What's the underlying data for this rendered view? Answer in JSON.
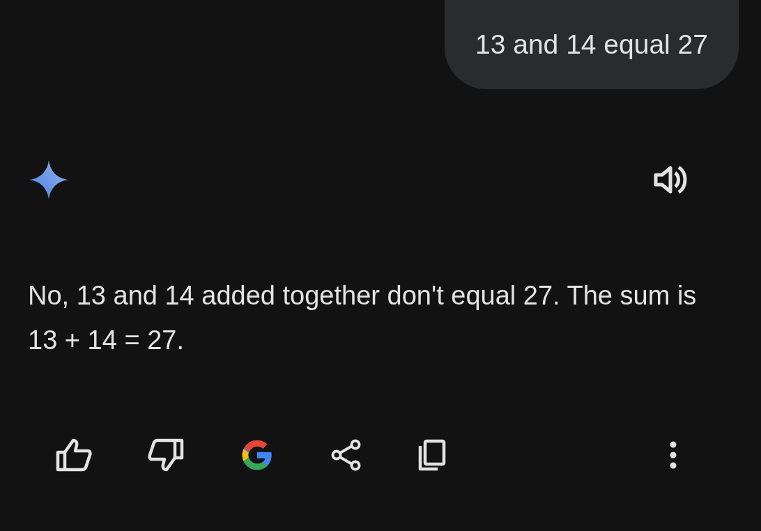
{
  "user_message": {
    "text": "13 and 14 equal 27"
  },
  "response": {
    "text": "No, 13 and 14 added together don't equal 27. The sum is 13 + 14 = 27."
  }
}
